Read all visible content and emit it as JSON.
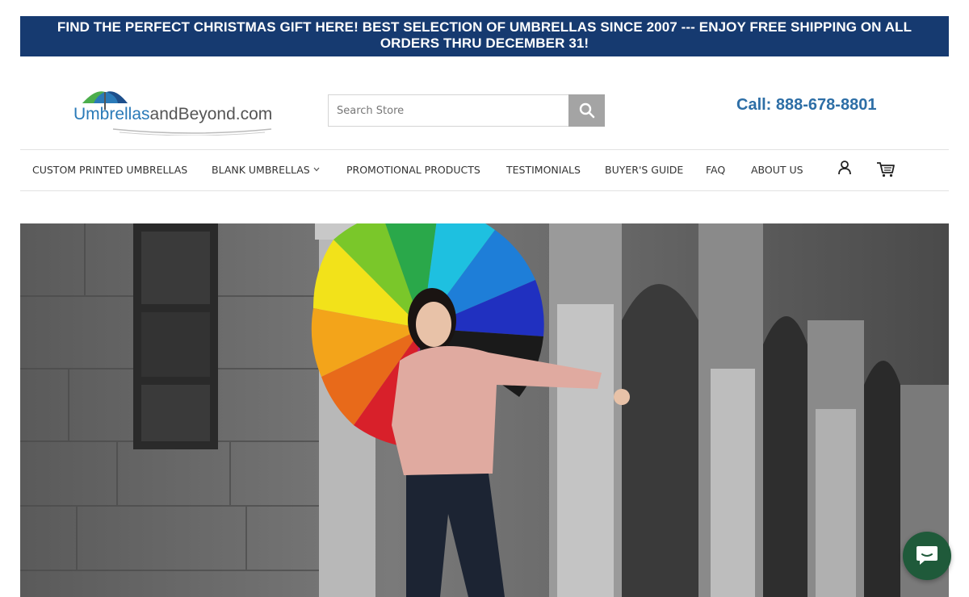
{
  "announcement": {
    "line1": "FIND THE PERFECT CHRISTMAS GIFT HERE! BEST SELECTION OF UMBRELLAS SINCE 2007 --- ENJOY FREE SHIPPING ON ALL",
    "line2": "ORDERS THRU DECEMBER 31!",
    "background": "#163a70"
  },
  "header": {
    "logo": {
      "part1": "Umbrellas",
      "part2": "andBeyond.com"
    },
    "search": {
      "placeholder": "Search Store",
      "value": "",
      "icon": "search-icon"
    },
    "phone": "Call: 888-678-8801"
  },
  "nav": {
    "items": [
      {
        "label": "CUSTOM PRINTED UMBRELLAS"
      },
      {
        "label": "BLANK UMBRELLAS",
        "dropdown": true
      },
      {
        "label": "PROMOTIONAL PRODUCTS"
      },
      {
        "label": "TESTIMONIALS"
      },
      {
        "label": "BUYER'S GUIDE"
      },
      {
        "label": "FAQ"
      },
      {
        "label": "ABOUT US"
      }
    ],
    "icons": [
      "account-icon",
      "cart-icon"
    ]
  },
  "hero": {
    "subject": "woman-with-rainbow-umbrella"
  },
  "chat": {
    "icon": "chat-icon",
    "color": "#1f5a3a"
  }
}
